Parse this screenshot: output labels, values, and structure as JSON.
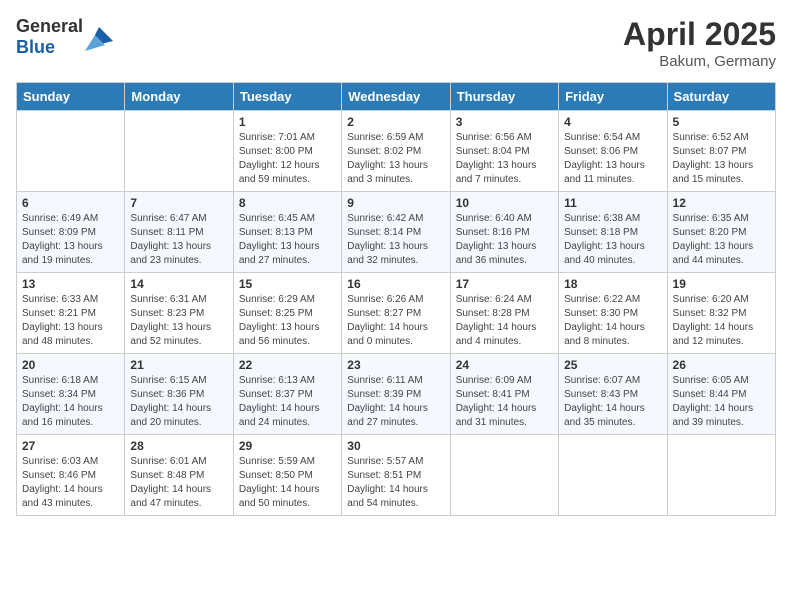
{
  "header": {
    "logo_general": "General",
    "logo_blue": "Blue",
    "title": "April 2025",
    "location": "Bakum, Germany"
  },
  "days_of_week": [
    "Sunday",
    "Monday",
    "Tuesday",
    "Wednesday",
    "Thursday",
    "Friday",
    "Saturday"
  ],
  "weeks": [
    [
      {
        "day": "",
        "info": ""
      },
      {
        "day": "",
        "info": ""
      },
      {
        "day": "1",
        "info": "Sunrise: 7:01 AM\nSunset: 8:00 PM\nDaylight: 12 hours and 59 minutes."
      },
      {
        "day": "2",
        "info": "Sunrise: 6:59 AM\nSunset: 8:02 PM\nDaylight: 13 hours and 3 minutes."
      },
      {
        "day": "3",
        "info": "Sunrise: 6:56 AM\nSunset: 8:04 PM\nDaylight: 13 hours and 7 minutes."
      },
      {
        "day": "4",
        "info": "Sunrise: 6:54 AM\nSunset: 8:06 PM\nDaylight: 13 hours and 11 minutes."
      },
      {
        "day": "5",
        "info": "Sunrise: 6:52 AM\nSunset: 8:07 PM\nDaylight: 13 hours and 15 minutes."
      }
    ],
    [
      {
        "day": "6",
        "info": "Sunrise: 6:49 AM\nSunset: 8:09 PM\nDaylight: 13 hours and 19 minutes."
      },
      {
        "day": "7",
        "info": "Sunrise: 6:47 AM\nSunset: 8:11 PM\nDaylight: 13 hours and 23 minutes."
      },
      {
        "day": "8",
        "info": "Sunrise: 6:45 AM\nSunset: 8:13 PM\nDaylight: 13 hours and 27 minutes."
      },
      {
        "day": "9",
        "info": "Sunrise: 6:42 AM\nSunset: 8:14 PM\nDaylight: 13 hours and 32 minutes."
      },
      {
        "day": "10",
        "info": "Sunrise: 6:40 AM\nSunset: 8:16 PM\nDaylight: 13 hours and 36 minutes."
      },
      {
        "day": "11",
        "info": "Sunrise: 6:38 AM\nSunset: 8:18 PM\nDaylight: 13 hours and 40 minutes."
      },
      {
        "day": "12",
        "info": "Sunrise: 6:35 AM\nSunset: 8:20 PM\nDaylight: 13 hours and 44 minutes."
      }
    ],
    [
      {
        "day": "13",
        "info": "Sunrise: 6:33 AM\nSunset: 8:21 PM\nDaylight: 13 hours and 48 minutes."
      },
      {
        "day": "14",
        "info": "Sunrise: 6:31 AM\nSunset: 8:23 PM\nDaylight: 13 hours and 52 minutes."
      },
      {
        "day": "15",
        "info": "Sunrise: 6:29 AM\nSunset: 8:25 PM\nDaylight: 13 hours and 56 minutes."
      },
      {
        "day": "16",
        "info": "Sunrise: 6:26 AM\nSunset: 8:27 PM\nDaylight: 14 hours and 0 minutes."
      },
      {
        "day": "17",
        "info": "Sunrise: 6:24 AM\nSunset: 8:28 PM\nDaylight: 14 hours and 4 minutes."
      },
      {
        "day": "18",
        "info": "Sunrise: 6:22 AM\nSunset: 8:30 PM\nDaylight: 14 hours and 8 minutes."
      },
      {
        "day": "19",
        "info": "Sunrise: 6:20 AM\nSunset: 8:32 PM\nDaylight: 14 hours and 12 minutes."
      }
    ],
    [
      {
        "day": "20",
        "info": "Sunrise: 6:18 AM\nSunset: 8:34 PM\nDaylight: 14 hours and 16 minutes."
      },
      {
        "day": "21",
        "info": "Sunrise: 6:15 AM\nSunset: 8:36 PM\nDaylight: 14 hours and 20 minutes."
      },
      {
        "day": "22",
        "info": "Sunrise: 6:13 AM\nSunset: 8:37 PM\nDaylight: 14 hours and 24 minutes."
      },
      {
        "day": "23",
        "info": "Sunrise: 6:11 AM\nSunset: 8:39 PM\nDaylight: 14 hours and 27 minutes."
      },
      {
        "day": "24",
        "info": "Sunrise: 6:09 AM\nSunset: 8:41 PM\nDaylight: 14 hours and 31 minutes."
      },
      {
        "day": "25",
        "info": "Sunrise: 6:07 AM\nSunset: 8:43 PM\nDaylight: 14 hours and 35 minutes."
      },
      {
        "day": "26",
        "info": "Sunrise: 6:05 AM\nSunset: 8:44 PM\nDaylight: 14 hours and 39 minutes."
      }
    ],
    [
      {
        "day": "27",
        "info": "Sunrise: 6:03 AM\nSunset: 8:46 PM\nDaylight: 14 hours and 43 minutes."
      },
      {
        "day": "28",
        "info": "Sunrise: 6:01 AM\nSunset: 8:48 PM\nDaylight: 14 hours and 47 minutes."
      },
      {
        "day": "29",
        "info": "Sunrise: 5:59 AM\nSunset: 8:50 PM\nDaylight: 14 hours and 50 minutes."
      },
      {
        "day": "30",
        "info": "Sunrise: 5:57 AM\nSunset: 8:51 PM\nDaylight: 14 hours and 54 minutes."
      },
      {
        "day": "",
        "info": ""
      },
      {
        "day": "",
        "info": ""
      },
      {
        "day": "",
        "info": ""
      }
    ]
  ]
}
